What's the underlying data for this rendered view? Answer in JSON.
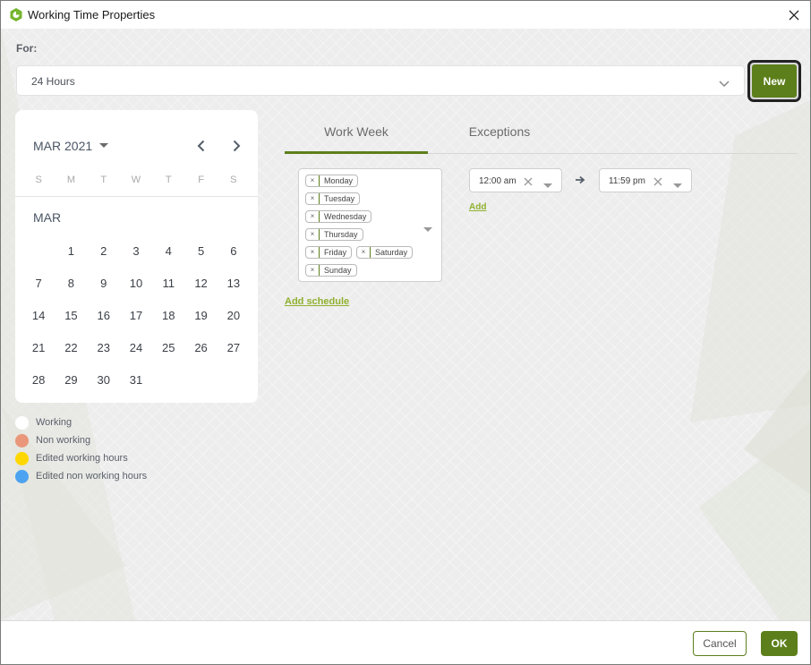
{
  "window": {
    "title": "Working Time Properties",
    "icon": "app-logo-icon",
    "close_icon": "close-icon"
  },
  "for_section": {
    "label": "For:",
    "selected": "24 Hours",
    "new_button": "New"
  },
  "calendar": {
    "month_year": "MAR 2021",
    "month_label": "MAR",
    "weekdays": [
      "S",
      "M",
      "T",
      "W",
      "T",
      "F",
      "S"
    ],
    "days": [
      "",
      "1",
      "2",
      "3",
      "4",
      "5",
      "6",
      "7",
      "8",
      "9",
      "10",
      "11",
      "12",
      "13",
      "14",
      "15",
      "16",
      "17",
      "18",
      "19",
      "20",
      "21",
      "22",
      "23",
      "24",
      "25",
      "26",
      "27",
      "28",
      "29",
      "30",
      "31",
      "",
      "",
      ""
    ]
  },
  "legend": [
    {
      "label": "Working",
      "color": "#ffffff"
    },
    {
      "label": "Non working",
      "color": "#e9967a"
    },
    {
      "label": "Edited working hours",
      "color": "#ffd700"
    },
    {
      "label": "Edited non working hours",
      "color": "#4da3f0"
    }
  ],
  "tabs": [
    {
      "label": "Work Week",
      "active": true
    },
    {
      "label": "Exceptions",
      "active": false
    }
  ],
  "schedule": {
    "days": [
      "Monday",
      "Tuesday",
      "Wednesday",
      "Thursday",
      "Friday",
      "Saturday",
      "Sunday"
    ],
    "start_time": "12:00 am",
    "end_time": "11:59 pm",
    "add_label": "Add",
    "add_schedule_label": "Add schedule"
  },
  "footer": {
    "cancel_label": "Cancel",
    "ok_label": "OK"
  },
  "colors": {
    "accent": "#5d7f1b",
    "link": "#8fb02e"
  }
}
